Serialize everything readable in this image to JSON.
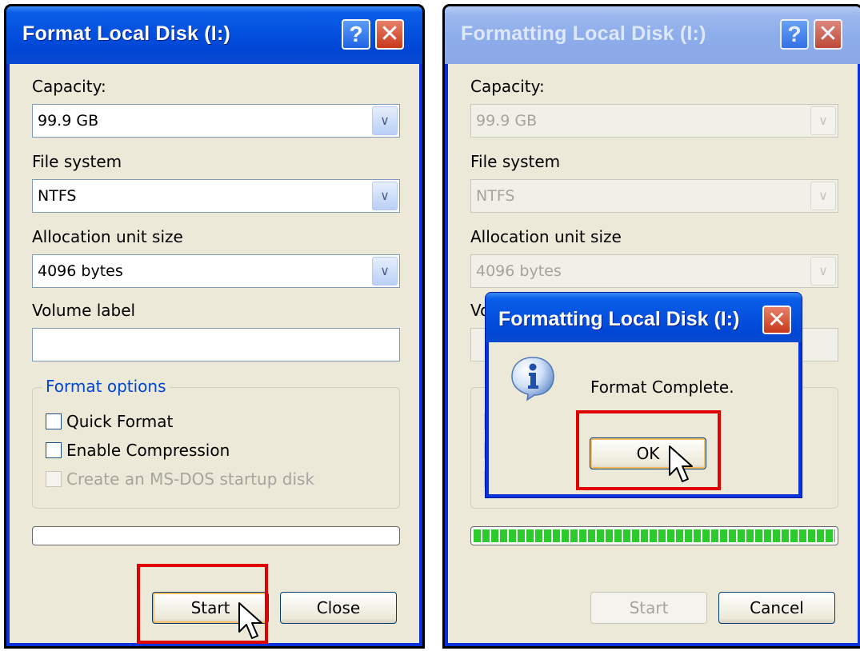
{
  "left_dialog": {
    "title": "Format Local Disk (I:)",
    "help_button": "?",
    "close_button": "✕",
    "capacity_label": "Capacity:",
    "capacity_value": "99.9 GB",
    "filesystem_label": "File system",
    "filesystem_value": "NTFS",
    "allocation_label": "Allocation unit size",
    "allocation_value": "4096 bytes",
    "volume_label": "Volume label",
    "volume_value": "",
    "format_options_title": "Format options",
    "quick_format": "Quick Format",
    "enable_compression": "Enable Compression",
    "msdos_startup": "Create an MS-DOS startup disk",
    "progress": 0,
    "start_button": "Start",
    "close_dialog_button": "Close"
  },
  "right_dialog": {
    "title": "Formatting Local Disk (I:)",
    "help_button": "?",
    "close_button": "✕",
    "capacity_label": "Capacity:",
    "capacity_value": "99.9 GB",
    "filesystem_label": "File system",
    "filesystem_value": "NTFS",
    "allocation_label": "Allocation unit size",
    "allocation_value": "4096 bytes",
    "volume_label_partial": "Vo",
    "progress": 1.0,
    "start_button": "Start",
    "cancel_button": "Cancel"
  },
  "message_box": {
    "title": "Formatting Local Disk (I:)",
    "close_button": "✕",
    "message": "Format Complete.",
    "ok_button": "OK",
    "icon": "info-icon"
  },
  "colors": {
    "highlight": "#e00000",
    "titlebar": "#0046d5",
    "progress_fill": "#2ccb2c"
  }
}
